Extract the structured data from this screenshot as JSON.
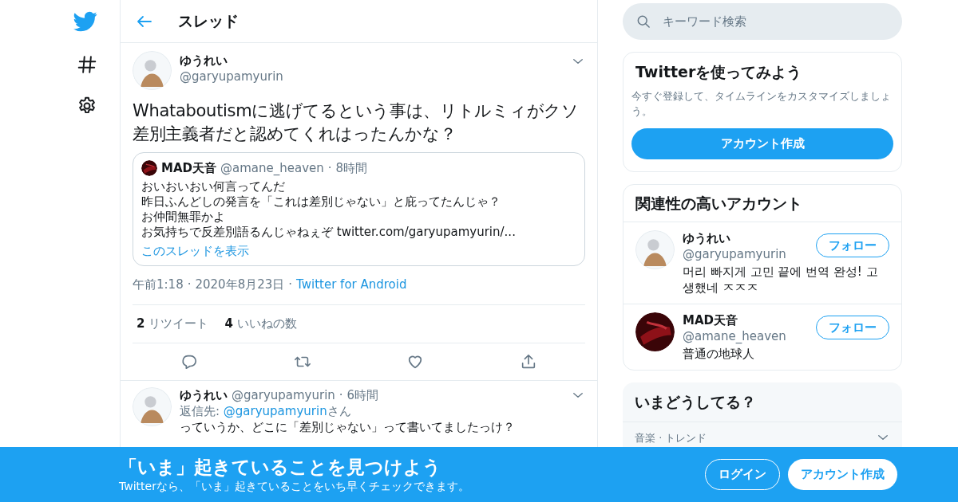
{
  "header": {
    "title": "スレッド"
  },
  "tweet": {
    "name": "ゆうれい",
    "handle": "@garyupamyurin",
    "avatar": {
      "kind": "light"
    },
    "text": "Whataboutismに逃げてるという事は、リトルミィがクソ差別主義者だと認めてくれはったんかな？",
    "quote": {
      "name": "MAD天音",
      "handle": "@amane_heaven",
      "separator": "·",
      "time": "8時間",
      "avatar": {
        "kind": "dark"
      },
      "lines": [
        "おいおいおい何言ってんだ",
        "昨日ふんどしの発言を「これは差別じゃない」と庇ってたんじゃ？",
        "お仲間無罪かよ",
        "お気持ちで反差別語るんじゃねぇぞ twitter.com/garyupamyurin/..."
      ],
      "show_thread": "このスレッドを表示"
    },
    "separator": "·",
    "time": "午前1:18",
    "date": "2020年8月23日",
    "source": "Twitter for Android",
    "stats": [
      {
        "count": "2",
        "label": "リツイート"
      },
      {
        "count": "4",
        "label": "いいねの数"
      }
    ]
  },
  "reply": {
    "name": "ゆうれい",
    "handle": "@garyupamyurin",
    "separator": "·",
    "time": "6時間",
    "avatar": {
      "kind": "light"
    },
    "reply_prefix": "返信先: ",
    "reply_handle": "@garyupamyurin",
    "reply_suffix": "さん",
    "text": "っていうか、どこに「差別じゃない」って書いてましたっけ？"
  },
  "search": {
    "placeholder": "キーワード検索"
  },
  "signup": {
    "title": "Twitterを使ってみよう",
    "text": "今すぐ登録して、タイムラインをカスタマイズしましょう。",
    "button": "アカウント作成"
  },
  "related": {
    "title": "関連性の高いアカウント",
    "accounts": [
      {
        "name": "ゆうれい",
        "handle": "@garyupamyurin",
        "bio": "머리 빠지게 고민 끝에 번역 완성! 고생했네 ㅈㅈㅈ",
        "follow": "フォロー",
        "avatar": {
          "kind": "light"
        }
      },
      {
        "name": "MAD天音",
        "handle": "@amane_heaven",
        "bio": "普通の地球人",
        "follow": "フォロー",
        "avatar": {
          "kind": "dark"
        }
      }
    ]
  },
  "trends": {
    "title": "いまどうしてる？",
    "items": [
      {
        "category": "音楽 · トレンド"
      }
    ]
  },
  "banner": {
    "title": "「いま」起きていることを見つけよう",
    "subtitle": "Twitterなら、「いま」起きていることをいち早くチェックできます。",
    "login": "ログイン",
    "signup": "アカウント作成"
  }
}
